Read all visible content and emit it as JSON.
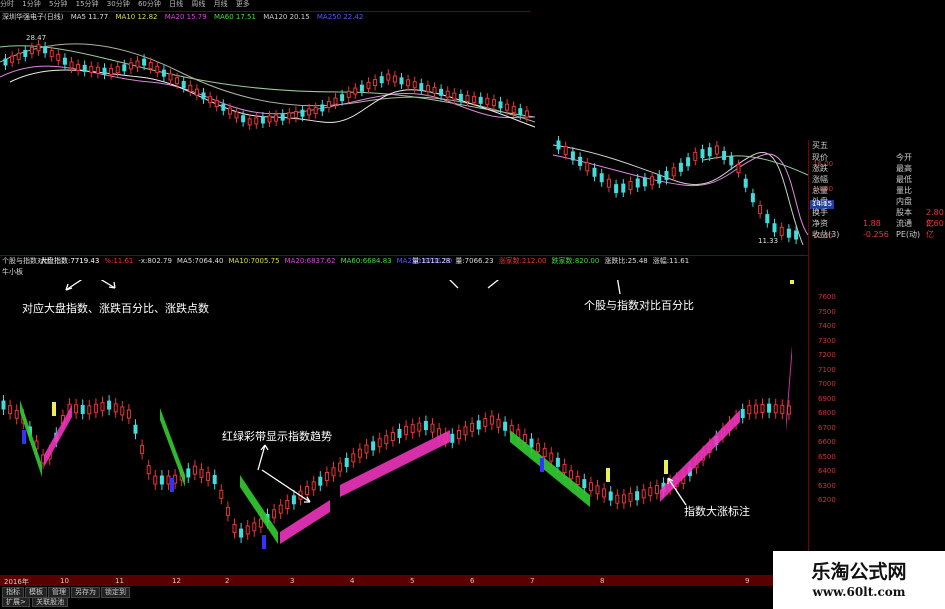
{
  "toolbar": {
    "periods": [
      "分时",
      "1分钟",
      "5分钟",
      "15分钟",
      "30分钟",
      "60分钟",
      "日线",
      "周线",
      "月线",
      "更多"
    ]
  },
  "upper_chart": {
    "name": "深圳华强电子(日线)",
    "ma_readouts": [
      "MA5 11.77",
      "MA10 12.82",
      "MA20 15.79",
      "MA60 17.51",
      "MA120 20.15",
      "MA250 22.42"
    ],
    "high_label": "28.47",
    "low_label": "11.33",
    "current_price": "14.15",
    "price_ticks": [
      "16.00",
      "14.00",
      "12.00"
    ]
  },
  "info_panel": {
    "title": "买五",
    "rows": [
      {
        "k": "现价",
        "v": "",
        "k2": "今开",
        "v2": ""
      },
      {
        "k": "涨跌",
        "v": "",
        "k2": "最高",
        "v2": ""
      },
      {
        "k": "涨幅",
        "v": "",
        "k2": "最低",
        "v2": ""
      },
      {
        "k": "总量",
        "v": "",
        "k2": "量比",
        "v2": ""
      },
      {
        "k": "外盘",
        "v": "",
        "k2": "内盘",
        "v2": ""
      },
      {
        "k": "换手",
        "v": "",
        "k2": "股本",
        "v2": "2.80亿"
      },
      {
        "k": "净资",
        "v": "1.88",
        "k2": "流通",
        "v2": "2.60亿"
      },
      {
        "k": "收益(3)",
        "v": "-0.256",
        "k2": "PE(动)",
        "v2": ""
      }
    ]
  },
  "lower_chart": {
    "indicator_name": "个股与指数对比",
    "readouts": [
      {
        "label": "大盘指数:",
        "value": "7719.43"
      },
      {
        "label": "%:",
        "value": "11.61"
      },
      {
        "label": "-x:",
        "value": "802.79"
      },
      {
        "label": "MA5:",
        "value": "7064.40"
      },
      {
        "label": "MA10:",
        "value": "7005.75"
      },
      {
        "label": "MA20:",
        "value": "6837.62"
      },
      {
        "label": "MA60:",
        "value": "6684.83"
      },
      {
        "label": "MA250:",
        "value": "6706.50"
      }
    ],
    "readouts2": [
      {
        "label": "量:",
        "value": "1111.28"
      },
      {
        "label": "量:",
        "value": "7066.23"
      },
      {
        "label": "涨家数:",
        "value": "212.00"
      },
      {
        "label": "跌家数:",
        "value": "820.00"
      },
      {
        "label": "涨跌比:",
        "value": "25.48"
      },
      {
        "label": "涨幅:",
        "value": "11.61"
      }
    ],
    "sub_label": "牛小板",
    "y_ticks": [
      "7600",
      "7500",
      "7400",
      "7300",
      "7200",
      "7100",
      "7000",
      "6900",
      "6800",
      "6700",
      "6600",
      "6500",
      "6400",
      "6300",
      "6200"
    ]
  },
  "annotations": {
    "a1": "对应大盘指数、涨跌百分比、涨跌点数",
    "a2": "个股与指数对比百分比",
    "a3": "红绿彩带显示指数趋势",
    "a4": "指数大涨标注"
  },
  "date_axis": [
    "2016年",
    "10",
    "11",
    "12",
    "2",
    "3",
    "4",
    "5",
    "6",
    "7",
    "8",
    "9"
  ],
  "bottom_tabs": [
    "指标",
    "模板",
    "管理",
    "另存为",
    "锁定到"
  ],
  "bottom_tabs2": [
    "扩展>",
    "关联股池"
  ],
  "watermark": {
    "title": "乐淘公式网",
    "url": "www.60lt.com"
  }
}
